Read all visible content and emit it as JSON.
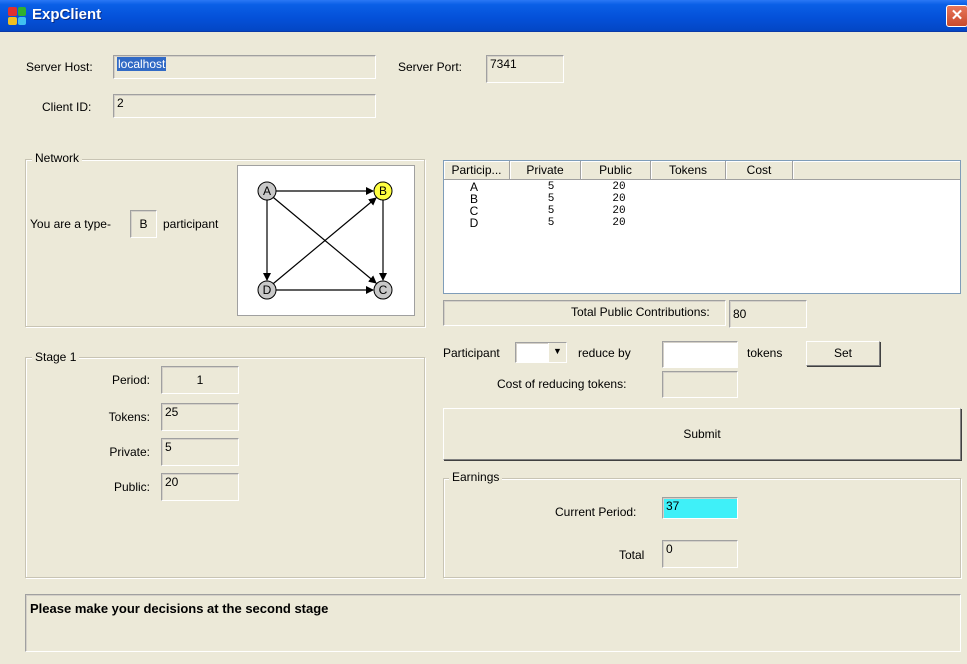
{
  "window": {
    "title": "ExpClient",
    "close_glyph": "✕"
  },
  "connection": {
    "server_host_label": "Server Host:",
    "server_host_value": "localhost",
    "server_port_label": "Server Port:",
    "server_port_value": "7341",
    "client_id_label": "Client ID:",
    "client_id_value": "2"
  },
  "network": {
    "group_title": "Network",
    "type_prefix": "You are a type-",
    "type_value": "B",
    "type_suffix": "participant",
    "nodes": [
      {
        "label": "A",
        "highlighted": false
      },
      {
        "label": "B",
        "highlighted": true
      },
      {
        "label": "D",
        "highlighted": false
      },
      {
        "label": "C",
        "highlighted": false
      }
    ],
    "colors": {
      "node_default": "#c8c8c8",
      "node_highlight": "#ffff40"
    }
  },
  "table": {
    "headers": [
      "Particip...",
      "Private",
      "Public",
      "Tokens",
      "Cost"
    ],
    "rows": [
      {
        "participant": "A",
        "private": "5",
        "public": "20",
        "tokens": "",
        "cost": ""
      },
      {
        "participant": "B",
        "private": "5",
        "public": "20",
        "tokens": "",
        "cost": ""
      },
      {
        "participant": "C",
        "private": "5",
        "public": "20",
        "tokens": "",
        "cost": ""
      },
      {
        "participant": "D",
        "private": "5",
        "public": "20",
        "tokens": "",
        "cost": ""
      }
    ],
    "total_label": "Total Public Contributions:",
    "total_value": "80"
  },
  "stage": {
    "group_title": "Stage 1",
    "period_label": "Period:",
    "period_value": "1",
    "tokens_label": "Tokens:",
    "tokens_value": "25",
    "private_label": "Private:",
    "private_value": "5",
    "public_label": "Public:",
    "public_value": "20"
  },
  "reduce": {
    "participant_label": "Participant",
    "participant_selected": "",
    "reduce_by_label": "reduce by",
    "reduce_by_value": "",
    "tokens_label": "tokens",
    "set_label": "Set",
    "cost_label": "Cost of reducing tokens:",
    "cost_value": ""
  },
  "submit_label": "Submit",
  "earnings": {
    "group_title": "Earnings",
    "current_label": "Current Period:",
    "current_value": "37",
    "total_label": "Total",
    "total_value": "0"
  },
  "status_message": "Please make your decisions at the second stage"
}
